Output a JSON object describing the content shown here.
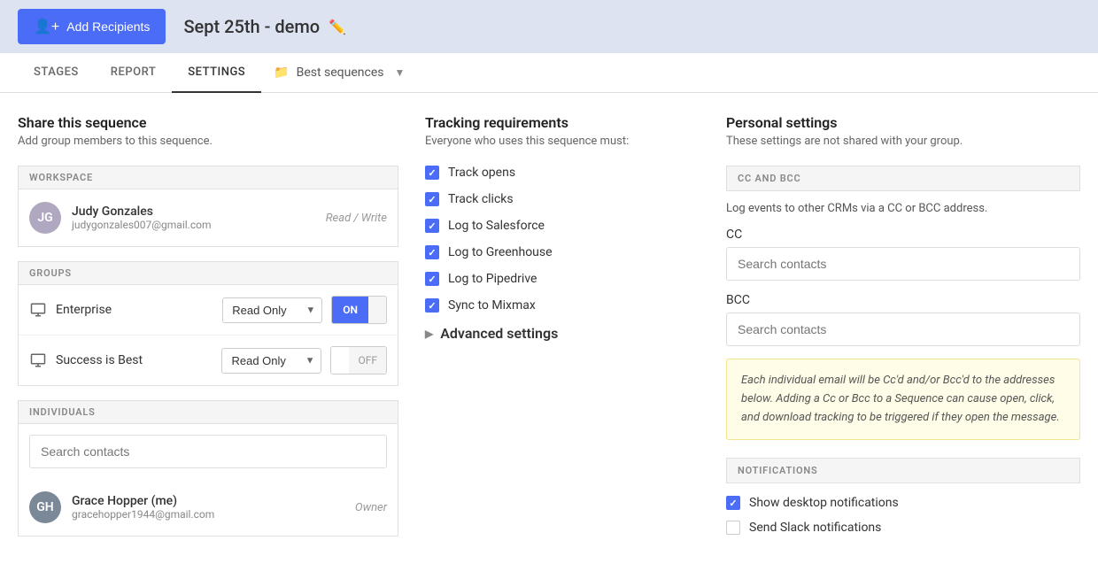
{
  "header": {
    "add_recipients_label": "Add Recipients",
    "title": "Sept 25th - demo"
  },
  "nav": {
    "tabs": [
      {
        "id": "stages",
        "label": "STAGES",
        "active": false
      },
      {
        "id": "report",
        "label": "REPORT",
        "active": false
      },
      {
        "id": "settings",
        "label": "SETTINGS",
        "active": true
      }
    ],
    "best_sequences_label": "Best sequences"
  },
  "share_section": {
    "title": "Share this sequence",
    "description": "Add group members to this sequence.",
    "workspace_header": "WORKSPACE",
    "workspace_user": {
      "name": "Judy Gonzales",
      "email": "judygonzales007@gmail.com",
      "role": "Read / Write"
    },
    "groups_header": "GROUPS",
    "groups": [
      {
        "name": "Enterprise",
        "permission": "Read Only",
        "toggle": "on"
      },
      {
        "name": "Success is Best",
        "permission": "Read Only",
        "toggle": "off"
      }
    ],
    "individuals_header": "INDIVIDUALS",
    "search_placeholder": "Search contacts",
    "individuals_user": {
      "name": "Grace Hopper (me)",
      "email": "gracehopper1944@gmail.com",
      "role": "Owner"
    }
  },
  "tracking_section": {
    "title": "Tracking requirements",
    "description": "Everyone who uses this sequence must:",
    "items": [
      "Track opens",
      "Track clicks",
      "Log to Salesforce",
      "Log to Greenhouse",
      "Log to Pipedrive",
      "Sync to Mixmax"
    ],
    "advanced_settings_label": "Advanced settings"
  },
  "personal_section": {
    "title": "Personal settings",
    "description": "These settings are not shared with your group.",
    "cc_bcc_header": "CC AND BCC",
    "cc_bcc_desc": "Log events to other CRMs via a CC or BCC address.",
    "cc_label": "CC",
    "cc_placeholder": "Search contacts",
    "bcc_label": "BCC",
    "bcc_placeholder": "Search contacts",
    "info_text": "Each individual email will be Cc'd and/or Bcc'd to the addresses below. Adding a Cc or Bcc to a Sequence can cause open, click, and download tracking to be triggered if they open the message.",
    "notifications_header": "NOTIFICATIONS",
    "notifications": [
      {
        "label": "Show desktop notifications",
        "checked": true
      },
      {
        "label": "Send Slack notifications",
        "checked": false
      }
    ]
  },
  "permissions": {
    "read_only": "Read Only",
    "read_write": "Read / Write",
    "owner": "Owner",
    "on": "ON",
    "off": "OFF"
  }
}
